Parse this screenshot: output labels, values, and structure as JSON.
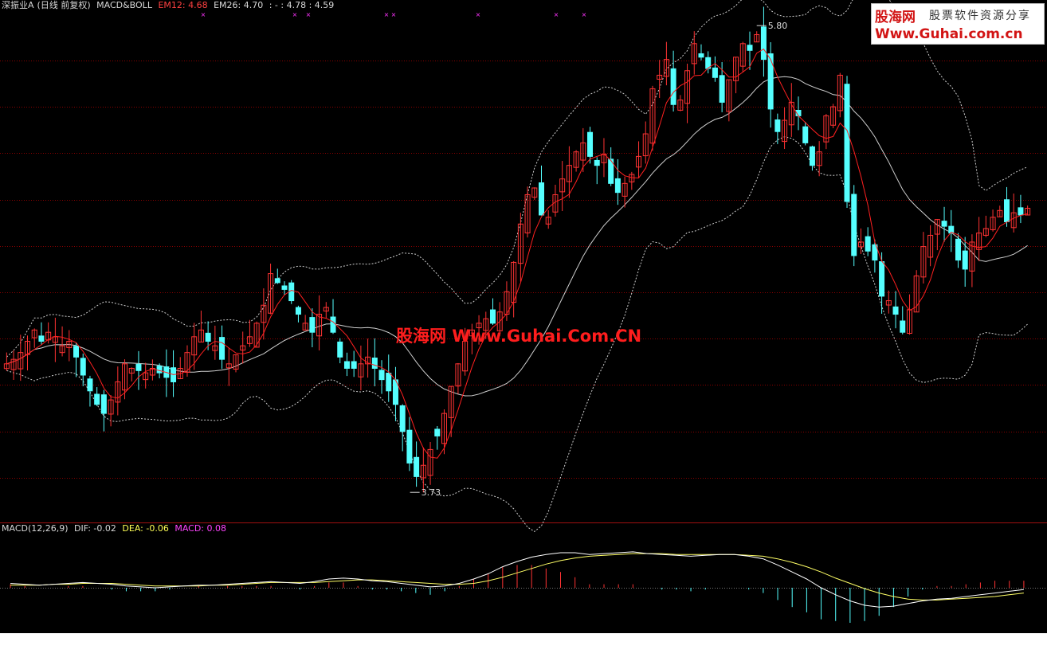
{
  "header": {
    "stock": "深振业A",
    "period": "(日线 前复权)",
    "indicator": "MACD&BOLL",
    "em12": "EM12: 4.68",
    "em26": "EM26: 4.70",
    "extra": ": - : 4.78 : 4.59"
  },
  "macd_header": {
    "name": "MACD(12,26,9)",
    "dif": "DIF: -0.02",
    "dea": "DEA: -0.06",
    "macd": "MACD: 0.08"
  },
  "watermark": "股海网 Www.Guhai.Com.CN",
  "logo": {
    "brand": "股海网",
    "slogan": "股票软件资源分享",
    "url": "Www.Guhai.com.cn"
  },
  "annotations": {
    "high": "5.80",
    "low": "3.73"
  },
  "colors": {
    "background": "#000000",
    "up": "#ff3333",
    "down": "#55ffff",
    "ma_red": "#ff2020",
    "boll": "#cfcfcf",
    "dif": "#ffffff",
    "dea": "#ffff66",
    "grid": "#8b0000"
  },
  "chart_data": {
    "type": "candlestick",
    "ylim": [
      3.6,
      5.85
    ],
    "high_label": 5.8,
    "low_label": 3.73,
    "closes": [
      4.3,
      4.32,
      4.35,
      4.4,
      4.45,
      4.4,
      4.44,
      4.42,
      4.38,
      4.4,
      4.33,
      4.25,
      4.18,
      4.12,
      4.08,
      4.14,
      4.22,
      4.3,
      4.28,
      4.27,
      4.26,
      4.28,
      4.26,
      4.24,
      4.22,
      4.28,
      4.35,
      4.42,
      4.45,
      4.4,
      4.38,
      4.32,
      4.3,
      4.34,
      4.38,
      4.42,
      4.48,
      4.56,
      4.7,
      4.66,
      4.63,
      4.58,
      4.52,
      4.48,
      4.44,
      4.52,
      4.55,
      4.44,
      4.33,
      4.28,
      4.28,
      4.3,
      4.33,
      4.28,
      4.23,
      4.18,
      4.12,
      4.0,
      3.86,
      3.8,
      3.85,
      3.92,
      3.98,
      4.08,
      4.2,
      4.3,
      4.4,
      4.45,
      4.48,
      4.5,
      4.48,
      4.53,
      4.62,
      4.75,
      4.92,
      5.05,
      5.08,
      4.96,
      4.95,
      5.05,
      5.12,
      5.18,
      5.24,
      5.28,
      5.22,
      5.18,
      5.23,
      5.1,
      5.06,
      5.1,
      5.14,
      5.22,
      5.32,
      5.52,
      5.58,
      5.65,
      5.45,
      5.47,
      5.6,
      5.72,
      5.66,
      5.61,
      5.57,
      5.46,
      5.56,
      5.66,
      5.72,
      5.69,
      5.76,
      5.65,
      5.43,
      5.33,
      5.38,
      5.46,
      5.4,
      5.28,
      5.18,
      5.24,
      5.4,
      5.44,
      5.58,
      5.02,
      4.78,
      4.84,
      4.8,
      4.76,
      4.6,
      4.58,
      4.52,
      4.44,
      4.54,
      4.69,
      4.82,
      4.87,
      4.94,
      4.91,
      4.88,
      4.76,
      4.72,
      4.84,
      4.88,
      4.9,
      4.95,
      4.98,
      4.93,
      4.97,
      4.96,
      4.99
    ],
    "dif": [
      0.05,
      0.04,
      0.03,
      0.04,
      0.05,
      0.06,
      0.05,
      0.04,
      0.02,
      0.01,
      0.0,
      0.01,
      0.02,
      0.03,
      0.03,
      0.04,
      0.05,
      0.06,
      0.07,
      0.06,
      0.05,
      0.07,
      0.1,
      0.11,
      0.1,
      0.08,
      0.07,
      0.05,
      0.03,
      0.01,
      0.02,
      0.05,
      0.1,
      0.16,
      0.24,
      0.3,
      0.35,
      0.38,
      0.4,
      0.4,
      0.38,
      0.39,
      0.4,
      0.41,
      0.39,
      0.38,
      0.37,
      0.36,
      0.37,
      0.38,
      0.38,
      0.36,
      0.33,
      0.26,
      0.18,
      0.1,
      0.0,
      -0.08,
      -0.15,
      -0.2,
      -0.22,
      -0.21,
      -0.18,
      -0.15,
      -0.13,
      -0.12,
      -0.1,
      -0.08,
      -0.06,
      -0.04,
      -0.02
    ],
    "dea": [
      0.03,
      0.03,
      0.03,
      0.04,
      0.04,
      0.05,
      0.05,
      0.05,
      0.04,
      0.03,
      0.02,
      0.02,
      0.02,
      0.02,
      0.03,
      0.03,
      0.04,
      0.05,
      0.06,
      0.06,
      0.06,
      0.06,
      0.07,
      0.08,
      0.09,
      0.09,
      0.08,
      0.07,
      0.06,
      0.05,
      0.04,
      0.04,
      0.05,
      0.08,
      0.12,
      0.17,
      0.22,
      0.27,
      0.31,
      0.34,
      0.36,
      0.37,
      0.38,
      0.39,
      0.39,
      0.39,
      0.38,
      0.38,
      0.38,
      0.38,
      0.38,
      0.37,
      0.36,
      0.33,
      0.29,
      0.24,
      0.18,
      0.11,
      0.05,
      -0.01,
      -0.06,
      -0.1,
      -0.13,
      -0.14,
      -0.14,
      -0.13,
      -0.12,
      -0.11,
      -0.1,
      -0.08,
      -0.06
    ],
    "macd": [
      0.04,
      0.02,
      0.0,
      0.0,
      0.02,
      0.02,
      0.0,
      -0.02,
      -0.04,
      -0.04,
      -0.04,
      -0.02,
      0.0,
      0.02,
      0.0,
      0.02,
      0.02,
      0.02,
      0.02,
      0.0,
      -0.02,
      0.02,
      0.06,
      0.06,
      0.02,
      -0.02,
      -0.02,
      -0.04,
      -0.06,
      -0.08,
      -0.04,
      0.02,
      0.1,
      0.16,
      0.24,
      0.26,
      0.26,
      0.22,
      0.18,
      0.12,
      0.04,
      0.04,
      0.04,
      0.04,
      0.0,
      -0.02,
      -0.02,
      -0.04,
      -0.02,
      0.0,
      0.0,
      -0.02,
      -0.06,
      -0.14,
      -0.22,
      -0.28,
      -0.36,
      -0.38,
      -0.4,
      -0.38,
      -0.32,
      -0.22,
      -0.1,
      -0.02,
      0.02,
      0.02,
      0.04,
      0.06,
      0.08,
      0.08,
      0.08
    ]
  }
}
